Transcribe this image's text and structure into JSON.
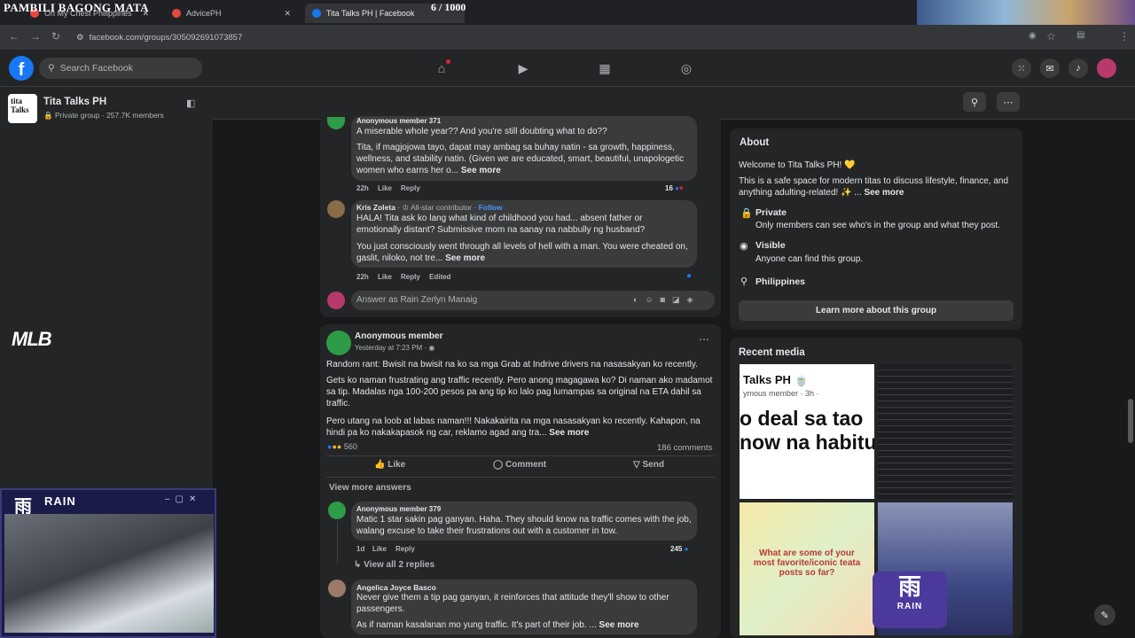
{
  "browser": {
    "overlay_title": "PAMBILI BAGONG MATA",
    "counter": "6 / 1000",
    "tabs": [
      {
        "label": "On My Chest Philippines"
      },
      {
        "label": "AdvicePH"
      },
      {
        "label": "Tita Talks PH | Facebook"
      }
    ],
    "url": "facebook.com/groups/305092691073857"
  },
  "fb": {
    "search_placeholder": "Search Facebook"
  },
  "group": {
    "name": "Tita Talks PH",
    "meta": "Private group · 257.7K members",
    "mlb": "MLB"
  },
  "post1": {
    "c1": {
      "author": "Anonymous member 371",
      "line1": "A miserable whole year?? And you're still doubting what to do??",
      "line2": "Tita, if magjojowa tayo, dapat may ambag sa buhay natin - sa growth, happiness, wellness, and stability natin. (Given we are educated, smart, beautiful, unapologetic women who earns her o...",
      "see_more": "See more",
      "time": "22h",
      "like": "Like",
      "reply": "Reply",
      "reacts": "16"
    },
    "c2": {
      "author": "Kris Zoleta",
      "badge": "All-star contributor",
      "follow": "Follow",
      "line1": "HALA! Tita ask ko lang what kind of childhood you had... absent father or emotionally distant? Submissive mom na sanay na nabbully ng husband?",
      "line2": "You just consciously went through all levels of hell with a man. You were cheated on, gaslit, niloko, not tre...",
      "see_more": "See more",
      "time": "22h",
      "like": "Like",
      "reply": "Reply",
      "edited": "Edited"
    },
    "answer_placeholder": "Answer as Rain Zerlyn Manaig"
  },
  "post2": {
    "author": "Anonymous member",
    "time": "Yesterday at 7:23 PM · ",
    "p1": "Random rant: Bwisit na bwisit na ko sa mga Grab at Indrive drivers na nasasakyan ko recently.",
    "p2": "Gets ko naman frustrating ang traffic recently. Pero anong magagawa ko? Di naman ako madamot sa tip. Madalas nga 100-200 pesos pa ang tip ko lalo pag lumampas sa original na ETA dahil sa traffic.",
    "p3": "Pero utang na loob at labas naman!!! Nakakairita na mga nasasakyan ko recently. Kahapon, na hindi pa ko nakakapasok ng car, reklamo agad ang tra...",
    "see_more": "See more",
    "reacts": "560",
    "comments": "186 comments",
    "like": "Like",
    "comment": "Comment",
    "send": "Send",
    "view_more": "View more answers",
    "c1": {
      "author": "Anonymous member 379",
      "text": "Matic 1 star sakin pag ganyan. Haha. They should know na traffic comes with the job, walang excuse to take their frustrations out with a customer in tow.",
      "time": "1d",
      "like": "Like",
      "reply": "Reply",
      "reacts": "245",
      "view_replies": "View all 2 replies"
    },
    "c2": {
      "author": "Angelica Joyce Basco",
      "line1": "Never give them a tip pag ganyan, it reinforces that attitude they'll show to other passengers.",
      "line2": "As if naman kasalanan mo yung traffic. It's part of their job. ...",
      "see_more": "See more"
    }
  },
  "about": {
    "title": "About",
    "welcome": "Welcome to Tita Talks PH! 💛",
    "desc": "This is a safe space for modern titas to discuss lifestyle, finance, and anything adulting-related! ✨ ...",
    "see_more": "See more",
    "private_title": "Private",
    "private_sub": "Only members can see who's in the group and what they post.",
    "visible_title": "Visible",
    "visible_sub": "Anyone can find this group.",
    "location": "Philippines",
    "learn_more": "Learn more about this group"
  },
  "media": {
    "title": "Recent media",
    "t1_head": "Talks PH 🍵",
    "t1_sub": "ymous member · 3h · ",
    "t1_big1": "o deal sa tao",
    "t1_big2": "now na habitu",
    "t3_text": "What are some of your most favorite/iconic teata posts so far?"
  },
  "stream": {
    "cam_brand": "RAIN",
    "cam_glyph": "雨",
    "wm_brand": "RAIN",
    "wm_glyph": "雨"
  },
  "colors": {
    "accent": "#1877f2",
    "bg": "#18191a",
    "card": "#242526",
    "green": "#2d9b47"
  }
}
